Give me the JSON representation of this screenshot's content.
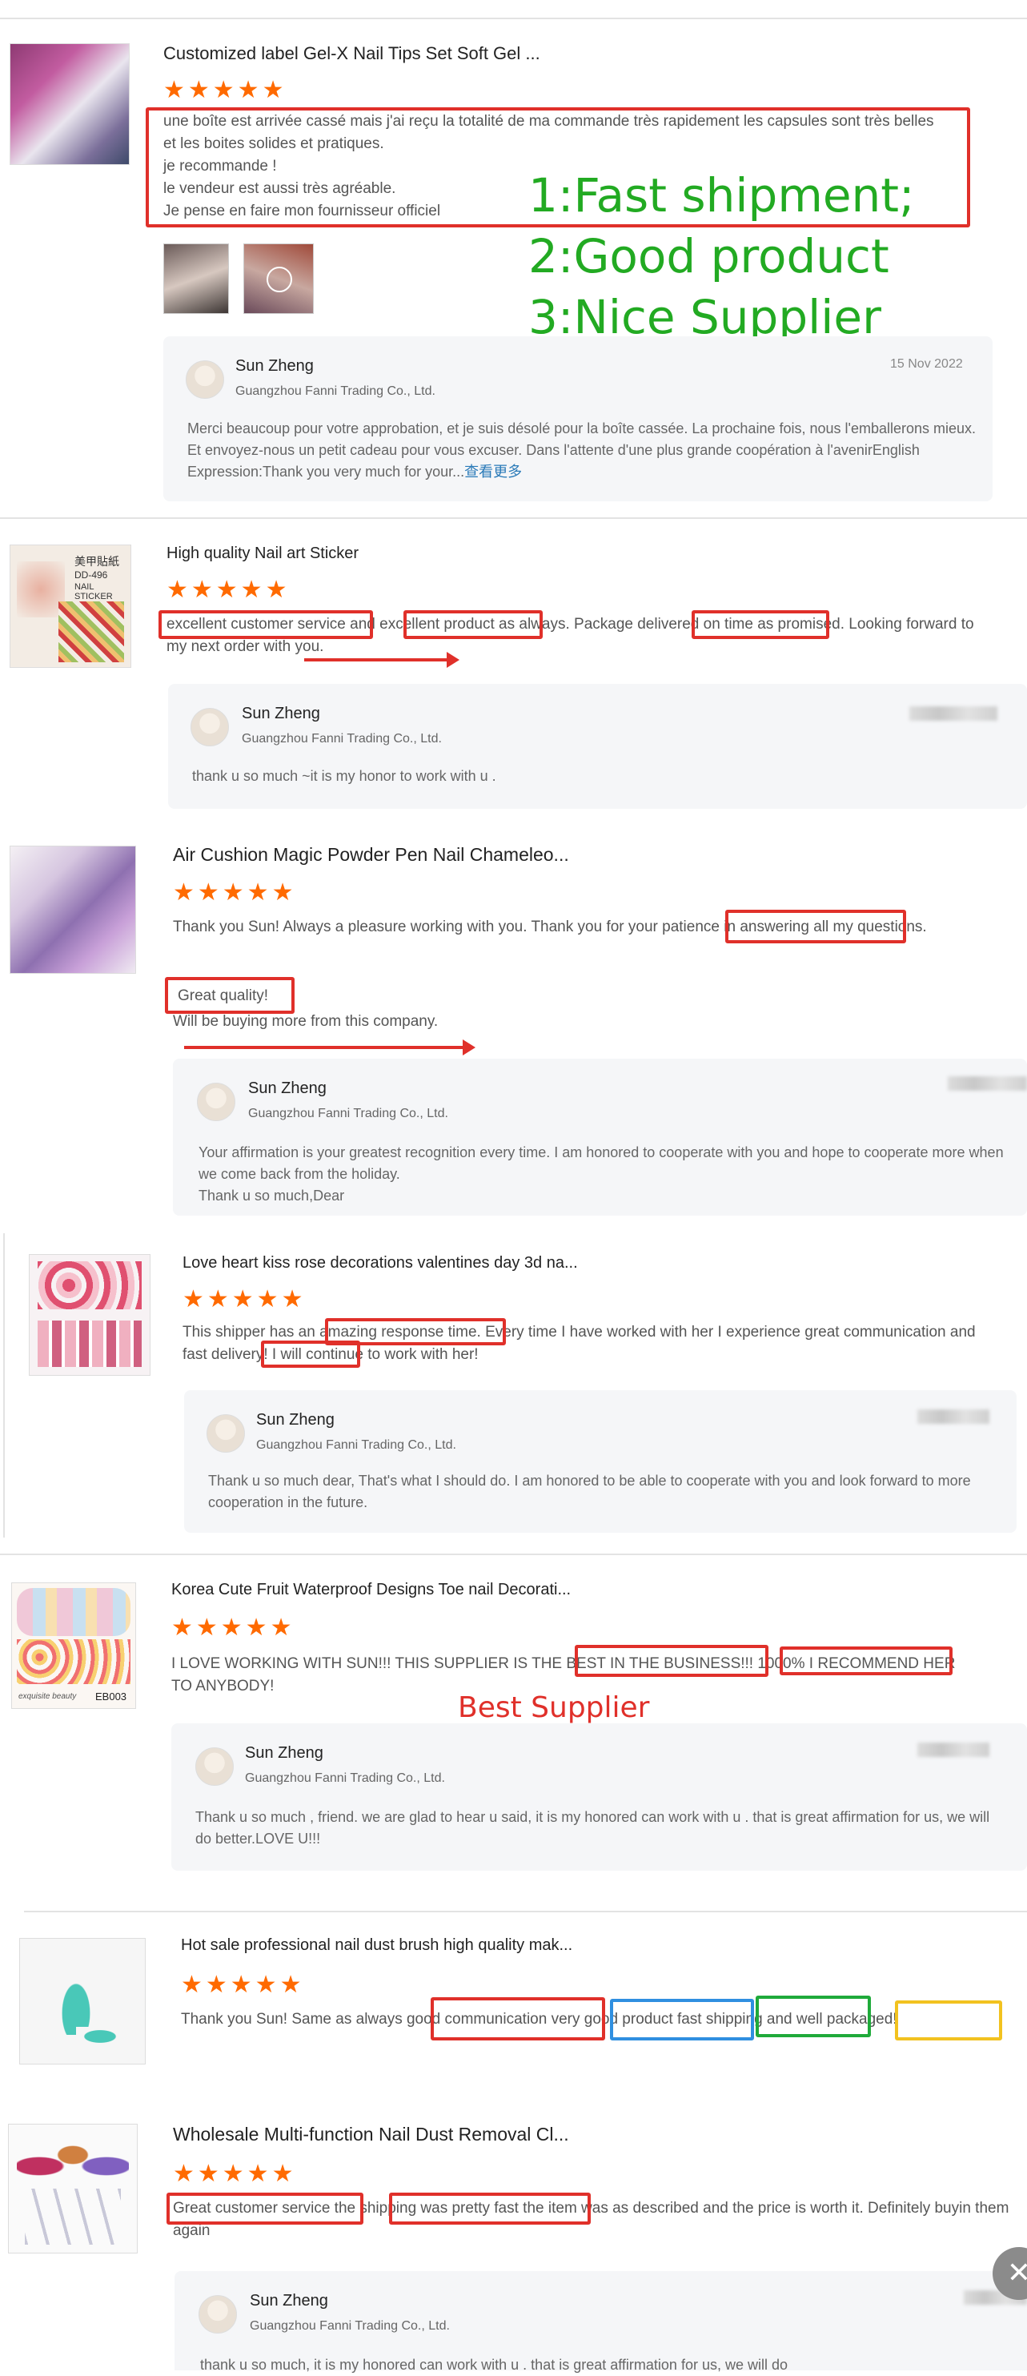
{
  "reviews": [
    {
      "product": "Customized label Gel-X Nail Tips Set Soft Gel ...",
      "stars": "★★★★★",
      "text": "une boîte est arrivée cassé mais j'ai reçu la totalité de ma commande très rapidement les capsules sont très belles et les boites solides et pratiques.\nje recommande !\nle vendeur est aussi très agréable.\nJe pense en faire mon fournisseur officiel",
      "reply_name": "Sun Zheng",
      "reply_company": "Guangzhou Fanni Trading Co., Ltd.",
      "reply_date": "15 Nov 2022",
      "reply_text": "Merci beaucoup pour votre approbation, et je suis désolé pour la boîte cassée.  La prochaine fois, nous l'emballerons mieux.  Et envoyez-nous un petit cadeau pour vous excuser.  Dans l'attente d'une plus grande coopération à l'avenirEnglish Expression:Thank you very much for your...",
      "reply_more": "查看更多"
    },
    {
      "product": "High quality Nail art Sticker",
      "stars": "★★★★★",
      "text": "excellent customer service and excellent product as always. Package delivered on time as promised. Looking forward to my next order with you.",
      "reply_name": "Sun Zheng",
      "reply_company": "Guangzhou Fanni Trading Co., Ltd.",
      "reply_text": "thank u so much ~it is my honor to work with u ."
    },
    {
      "product": "Air Cushion Magic Powder Pen Nail Chameleo...",
      "stars": "★★★★★",
      "text": "Thank you Sun! Always a pleasure working with you. Thank you for your patience in answering all my questions.",
      "text2": "Great quality!",
      "text3": "Will be buying more from this company.",
      "reply_name": "Sun Zheng",
      "reply_company": "Guangzhou Fanni Trading Co., Ltd.",
      "reply_text": "Your affirmation is your greatest recognition every time. I am honored to cooperate with you and hope to cooperate more when we come back from the holiday.\nThank u so much,Dear"
    },
    {
      "product": "Love heart kiss rose decorations valentines day 3d na...",
      "stars": "★★★★★",
      "text": "This shipper has an amazing response time. Every time I have worked with her I experience great communication and fast delivery! I will continue to work with her!",
      "reply_name": "Sun Zheng",
      "reply_company": "Guangzhou Fanni Trading Co., Ltd.",
      "reply_text": "Thank u so much dear, That's what I should do. I am honored to be able to cooperate with you and look forward to more cooperation in the future."
    },
    {
      "product": "Korea Cute Fruit Waterproof Designs Toe nail Decorati...",
      "stars": "★★★★★",
      "text": "I LOVE WORKING WITH SUN!!! THIS SUPPLIER IS THE BEST IN THE BUSINESS!!! 1000% I RECOMMEND HER TO ANYBODY!",
      "reply_name": "Sun Zheng",
      "reply_company": "Guangzhou Fanni Trading Co., Ltd.",
      "reply_text": "Thank u so much , friend. we are glad to hear u said, it is my honored can work with u . that is great affirmation for us, we will do better.LOVE U!!!"
    },
    {
      "product": "Hot sale professional nail dust brush high quality mak...",
      "stars": "★★★★★",
      "text": "Thank you Sun! Same as always good communication very good product fast shipping and well packaged!"
    },
    {
      "product": "Wholesale Multi-function Nail Dust Removal Cl...",
      "stars": "★★★★★",
      "text": "Great customer service the shipping was pretty fast the item was as described and the price is worth it. Definitely buyin them again",
      "reply_name": "Sun Zheng",
      "reply_company": "Guangzhou Fanni Trading Co., Ltd.",
      "reply_text": "thank u so much, it is my honored can work with u . that is great affirmation for us, we will do"
    }
  ],
  "annotations": {
    "line1": "1:Fast shipment;",
    "line2": "2:Good product",
    "line3": "3:Nice Supplier",
    "best": "Best Supplier"
  },
  "thumb_labels": {
    "sticker_title": "美甲貼紙",
    "sticker_code": "DD-496",
    "sticker_sub": "NAIL STICKER",
    "toe_brand": "exquisite beauty",
    "toe_code": "EB003"
  },
  "colors": {
    "star": "#ff6a00",
    "highlight_red": "#e0302a",
    "highlight_blue": "#2f8fe0",
    "highlight_green": "#1faa3a",
    "highlight_yellow": "#f2c21f",
    "annotation_green": "#22aa22"
  },
  "icons": {
    "close": "close-icon"
  }
}
